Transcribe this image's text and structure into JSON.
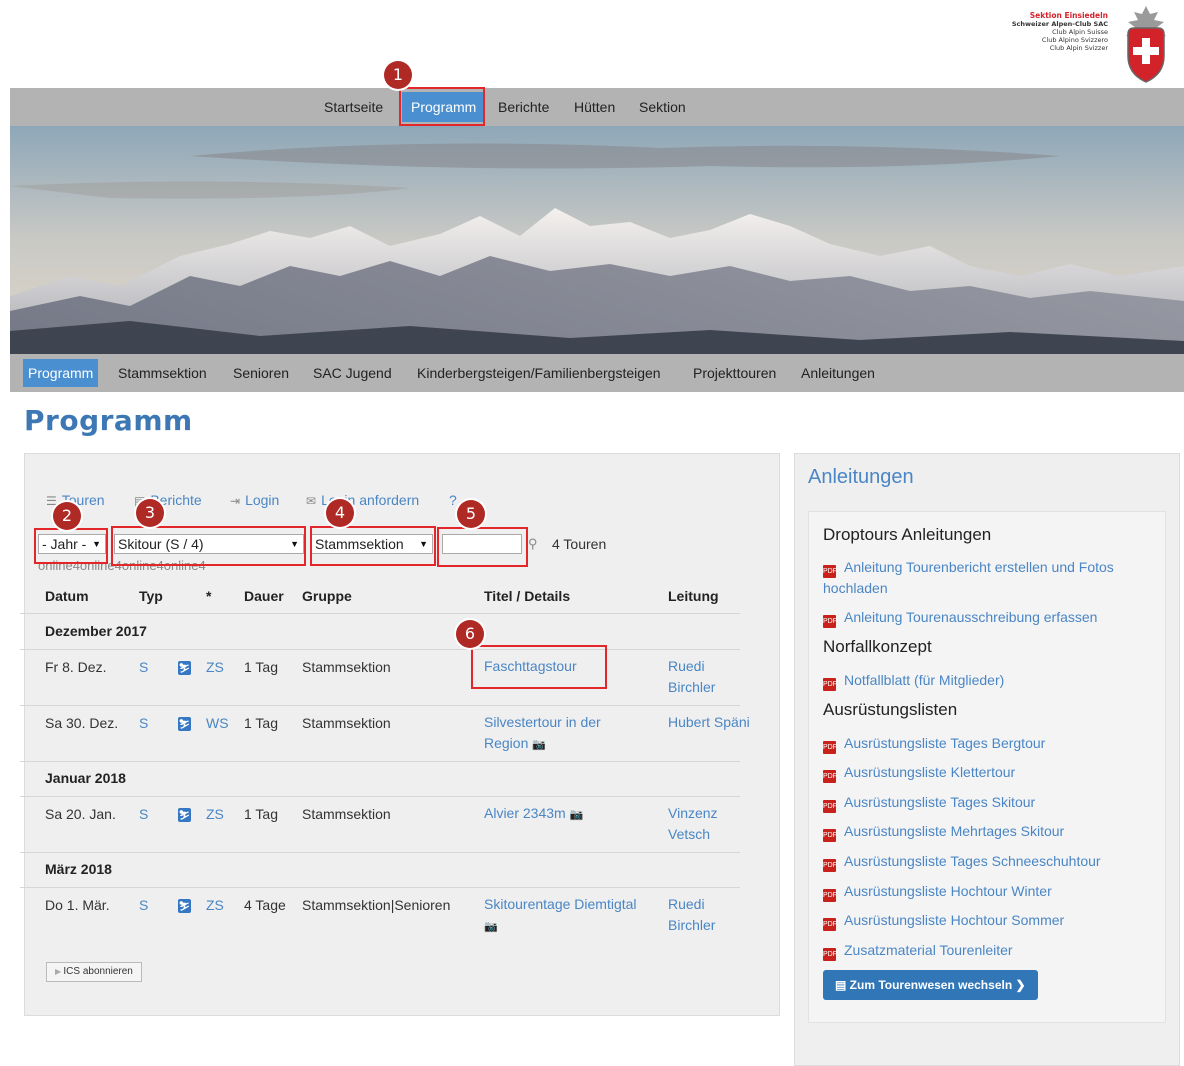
{
  "logo": {
    "line1": "Sektion Einsiedeln",
    "line2": "Schweizer Alpen-Club SAC",
    "line3": "Club Alpin Suisse",
    "line4": "Club Alpino Svizzero",
    "line5": "Club Alpin Svizzer"
  },
  "top_nav": [
    "Startseite",
    "Programm",
    "Berichte",
    "Hütten",
    "Sektion"
  ],
  "sub_nav": [
    "Programm",
    "Stammsektion",
    "Senioren",
    "SAC Jugend",
    "Kinderbergsteigen/Familienbergsteigen",
    "Projekttouren",
    "Anleitungen"
  ],
  "page_title": "Programm",
  "toolbar": {
    "touren": "Touren",
    "berichte": "Berichte",
    "login": "Login",
    "login_anfordern": "Login anfordern",
    "help": "?"
  },
  "filters": {
    "jahr": "- Jahr -",
    "typ": "Skitour (S / 4)",
    "gruppe": "Stammsektion",
    "search_value": "",
    "count": "4 Touren"
  },
  "stray_text": "online4online4online4online4",
  "table": {
    "headers": [
      "Datum",
      "Typ",
      "*",
      "Dauer",
      "Gruppe",
      "Titel / Details",
      "Leitung"
    ],
    "groups": [
      {
        "month": "Dezember 2017",
        "rows": [
          {
            "datum": "Fr 8. Dez.",
            "typ": "S",
            "icon": "skier-icon",
            "diff": "ZS",
            "dauer": "1 Tag",
            "gruppe": "Stammsektion",
            "titel": "Faschttagstour",
            "leitung": "Ruedi Birchler"
          },
          {
            "datum": "Sa 30. Dez.",
            "typ": "S",
            "icon": "skier-icon",
            "diff": "WS",
            "dauer": "1 Tag",
            "gruppe": "Stammsektion",
            "titel": "Silvestertour in der Region",
            "leitung": "Hubert Späni"
          }
        ]
      },
      {
        "month": "Januar 2018",
        "rows": [
          {
            "datum": "Sa 20. Jan.",
            "typ": "S",
            "icon": "skier-icon",
            "diff": "ZS",
            "dauer": "1 Tag",
            "gruppe": "Stammsektion",
            "titel": "Alvier 2343m",
            "leitung": "Vinzenz Vetsch"
          }
        ]
      },
      {
        "month": "März 2018",
        "rows": [
          {
            "datum": "Do 1. Mär.",
            "typ": "S",
            "icon": "skier-icon",
            "diff": "ZS",
            "dauer": "4 Tage",
            "gruppe": "Stammsektion|Senioren",
            "titel": "Skitourentage Diemtigtal",
            "leitung": "Ruedi Birchler"
          }
        ]
      }
    ]
  },
  "ics_button": "ICS abonnieren",
  "badges": [
    "1",
    "2",
    "3",
    "4",
    "5",
    "6"
  ],
  "sidebar": {
    "title": "Anleitungen",
    "sections": [
      {
        "heading": "Droptours Anleitungen",
        "links": [
          "Anleitung Tourenbericht erstellen und Fotos hochladen",
          "Anleitung Tourenausschreibung erfassen"
        ]
      },
      {
        "heading": "Norfallkonzept",
        "links": [
          "Notfallblatt (für Mitglieder)"
        ]
      },
      {
        "heading": "Ausrüstungslisten",
        "links": [
          "Ausrüstungsliste Tages Bergtour",
          "Ausrüstungsliste Klettertour",
          "Ausrüstungsliste Tages Skitour",
          "Ausrüstungsliste Mehrtages Skitour",
          "Ausrüstungsliste Tages Schneeschuhtour",
          "Ausrüstungsliste Hochtour Winter",
          "Ausrüstungsliste Hochtour Sommer",
          "Zusatzmaterial Tourenleiter"
        ]
      }
    ],
    "button": "Zum Tourenwesen wechseln"
  },
  "colors": {
    "accent": "#4a8fd0",
    "nav_bg": "#b3b3b3",
    "link": "#4a86c5",
    "title": "#3d78b4",
    "highlight": "#e2262a",
    "badge": "#b02a25",
    "pdf": "#c8211c"
  }
}
